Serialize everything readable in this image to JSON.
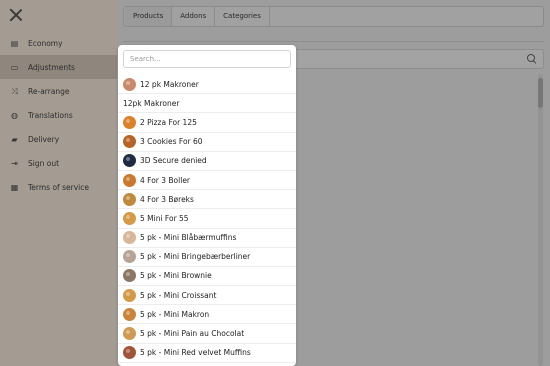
{
  "sidebar": {
    "items": [
      {
        "label": "Economy",
        "icon": "receipt-icon",
        "glyph": "▤",
        "active": false
      },
      {
        "label": "Adjustments",
        "icon": "id-card-icon",
        "glyph": "▭",
        "active": true
      },
      {
        "label": "Re-arrange",
        "icon": "shuffle-icon",
        "glyph": "⤨",
        "active": false
      },
      {
        "label": "Translations",
        "icon": "globe-icon",
        "glyph": "◍",
        "active": false
      },
      {
        "label": "Delivery",
        "icon": "truck-icon",
        "glyph": "▰",
        "active": false
      },
      {
        "label": "Sign out",
        "icon": "sign-out-icon",
        "glyph": "⇥",
        "active": false
      },
      {
        "label": "Terms of service",
        "icon": "document-icon",
        "glyph": "▦",
        "active": false
      }
    ]
  },
  "tabs": [
    {
      "label": "Products",
      "active": true
    },
    {
      "label": "Addons",
      "active": false
    },
    {
      "label": "Categories",
      "active": false
    }
  ],
  "dropdown": {
    "search_placeholder": "Search...",
    "items": [
      {
        "label": "12 pk Makroner",
        "thumb": true,
        "color": "#c98a6b"
      },
      {
        "label": "12pk Makroner",
        "thumb": false,
        "color": ""
      },
      {
        "label": "2 Pizza For 125",
        "thumb": true,
        "color": "#d9822b"
      },
      {
        "label": "3 Cookies For 60",
        "thumb": true,
        "color": "#b5652a"
      },
      {
        "label": "3D Secure denied",
        "thumb": true,
        "color": "#1f2a44"
      },
      {
        "label": "4 For 3 Boller",
        "thumb": true,
        "color": "#c8792f"
      },
      {
        "label": "4 For 3 Børeks",
        "thumb": true,
        "color": "#c08a3e"
      },
      {
        "label": "5 Mini For 55",
        "thumb": true,
        "color": "#d49a4a"
      },
      {
        "label": "5 pk - Mini Blåbærmuffins",
        "thumb": true,
        "color": "#d8b69a"
      },
      {
        "label": "5 pk - Mini Bringebærberliner",
        "thumb": true,
        "color": "#b9a395"
      },
      {
        "label": "5 pk - Mini Brownie",
        "thumb": true,
        "color": "#8c7666"
      },
      {
        "label": "5 pk - Mini Croissant",
        "thumb": true,
        "color": "#d39a4d"
      },
      {
        "label": "5 pk - Mini Makron",
        "thumb": true,
        "color": "#c9843c"
      },
      {
        "label": "5 pk - Mini Pain au Chocolat",
        "thumb": true,
        "color": "#cf9a55"
      },
      {
        "label": "5 pk - Mini Red velvet Muffins",
        "thumb": true,
        "color": "#a0553a"
      }
    ]
  }
}
